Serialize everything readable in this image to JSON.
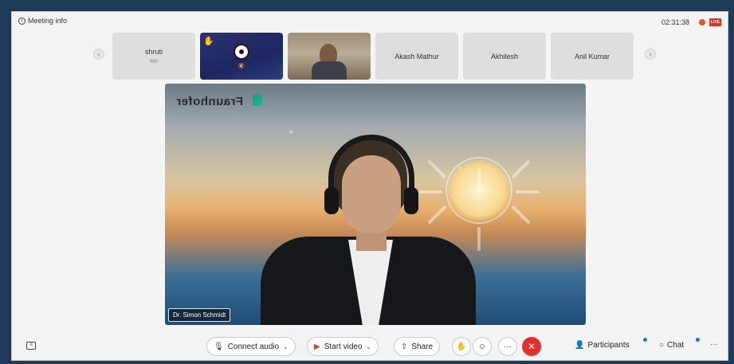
{
  "header": {
    "meeting_info_label": "Meeting info",
    "info_icon": "i",
    "clock": "02:31:38",
    "live_label": "LIVE"
  },
  "strip": {
    "prev_glyph": "‹",
    "next_glyph": "›",
    "tiles": [
      {
        "name": "shruti",
        "sub": "Me"
      },
      {
        "name": "",
        "raised_hand_icon": "✋",
        "mute_icon": "🔇"
      },
      {
        "name": ""
      },
      {
        "name": "Akash Mathur"
      },
      {
        "name": "Akhilesh"
      },
      {
        "name": "Anil Kumar"
      }
    ]
  },
  "main_video": {
    "speaker_name": "Dr. Simon Schmidt",
    "background_logo": "Fraunhofer"
  },
  "toolbar": {
    "chat_side_glyph": "≡",
    "connect_audio_icon": "🎙",
    "connect_audio": "Connect audio",
    "chevron": "⌄",
    "start_video_icon": "▶",
    "start_video": "Start video",
    "share_icon": "⇧",
    "share": "Share",
    "hand_icon": "✋",
    "reaction_icon": "☺",
    "more_icon": "···",
    "end_icon": "✕",
    "participants_icon": "👤",
    "participants": "Participants",
    "chat_icon": "○",
    "chat": "Chat",
    "more_right": "···"
  },
  "colors": {
    "accent": "#2f6ad9",
    "end_call": "#e3302b",
    "live": "#d9342b"
  }
}
